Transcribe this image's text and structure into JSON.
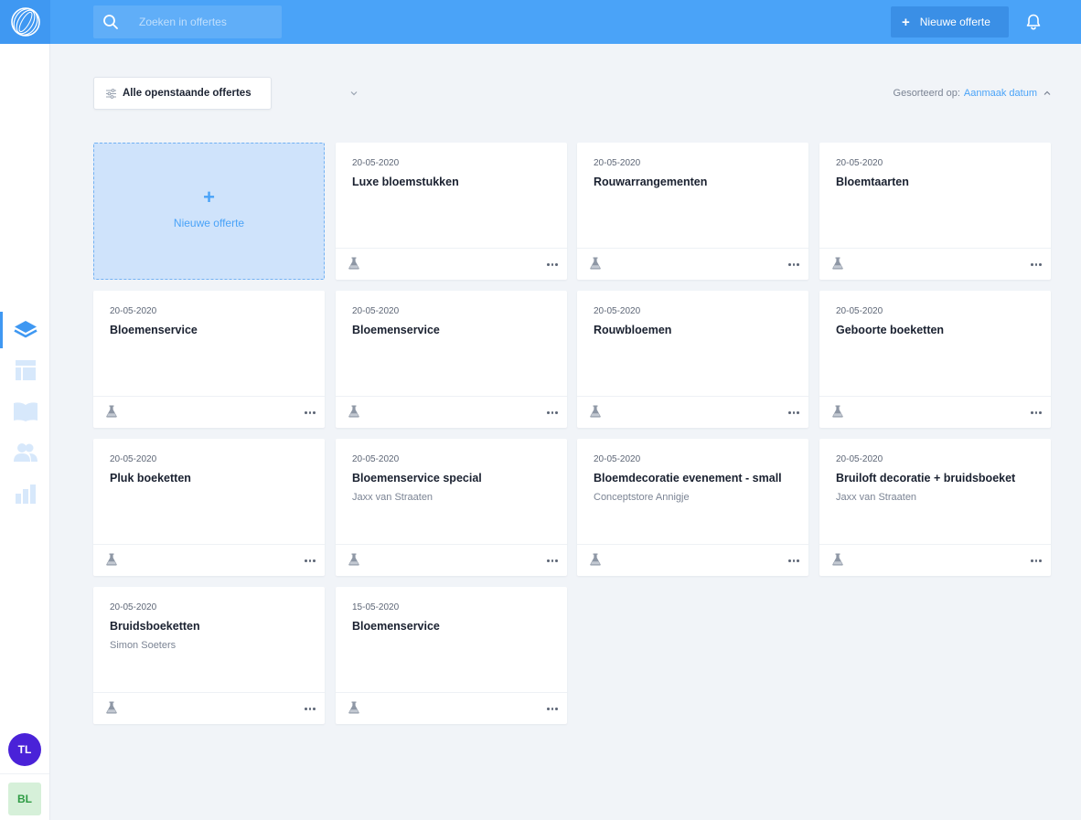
{
  "header": {
    "search_placeholder": "Zoeken in offertes",
    "new_button_label": "Nieuwe offerte"
  },
  "sidebar": {
    "items": [
      {
        "name": "layers-icon",
        "active": true
      },
      {
        "name": "layout-icon",
        "active": false
      },
      {
        "name": "book-icon",
        "active": false
      },
      {
        "name": "users-icon",
        "active": false
      },
      {
        "name": "bar-chart-icon",
        "active": false
      }
    ],
    "avatars": [
      "TL",
      "BL"
    ]
  },
  "toolbar": {
    "filter_label": "Alle openstaande offertes",
    "sort_prefix": "Gesorteerd op:",
    "sort_value": "Aanmaak datum"
  },
  "new_card": {
    "plus": "+",
    "label": "Nieuwe offerte"
  },
  "cards": [
    {
      "date": "20-05-2020",
      "title": "Luxe bloemstukken",
      "client": ""
    },
    {
      "date": "20-05-2020",
      "title": "Rouwarrangementen",
      "client": ""
    },
    {
      "date": "20-05-2020",
      "title": "Bloemtaarten",
      "client": ""
    },
    {
      "date": "20-05-2020",
      "title": "Bloemenservice",
      "client": ""
    },
    {
      "date": "20-05-2020",
      "title": "Bloemenservice",
      "client": ""
    },
    {
      "date": "20-05-2020",
      "title": "Rouwbloemen",
      "client": ""
    },
    {
      "date": "20-05-2020",
      "title": "Geboorte boeketten",
      "client": ""
    },
    {
      "date": "20-05-2020",
      "title": "Pluk boeketten",
      "client": ""
    },
    {
      "date": "20-05-2020",
      "title": "Bloemenservice special",
      "client": "Jaxx van Straaten"
    },
    {
      "date": "20-05-2020",
      "title": "Bloemdecoratie evenement - small",
      "client": "Conceptstore Annigje"
    },
    {
      "date": "20-05-2020",
      "title": "Bruiloft decoratie + bruidsboeket",
      "client": "Jaxx van Straaten"
    },
    {
      "date": "20-05-2020",
      "title": "Bruidsboeketten",
      "client": "Simon Soeters"
    },
    {
      "date": "15-05-2020",
      "title": "Bloemenservice",
      "client": ""
    }
  ],
  "colors": {
    "brand": "#4aa3f8",
    "avatar_tl": "#4a22d8",
    "avatar_bl": "#d6f0d9"
  }
}
